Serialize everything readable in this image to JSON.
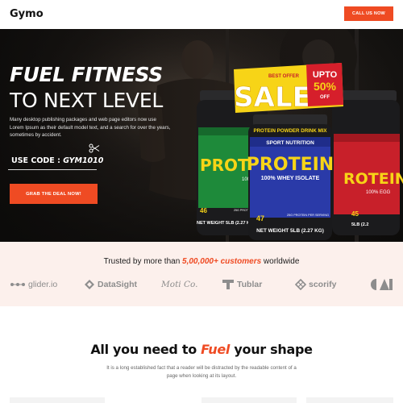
{
  "header": {
    "logo": "Gymo",
    "cta_label": "CALL US NOW"
  },
  "hero": {
    "title_line1": "FUEL FITNESS",
    "title_line2": "TO NEXT LEVEL",
    "description": "Many desktop publishing packages and web page editors now use Lorem Ipsum as their default model text, and a search for over the years, sometimes by accident.",
    "code_label": "USE CODE : ",
    "code_value": "GYM1010",
    "cta_label": "GRAB THE DEAL NOW!"
  },
  "promo": {
    "best_offer": "BEST OFFER",
    "sale": "SALE",
    "upto": "UPTO",
    "percent": "50%",
    "off": "OFF"
  },
  "products": [
    {
      "top_label": "PROTEIN POWDER DRINK MIX",
      "line": "SPORT NUTRITION",
      "name": "PROTEIN",
      "sub": "100% WHEY ISOLATE",
      "serving_num": "47",
      "serving_text": "25G PROTEIN PER SERVING",
      "weight": "NET WEIGHT 5LB (2.27 KG)"
    },
    {
      "left_name": "PROTEIN",
      "left_sub": "100%",
      "left_num": "46",
      "left_serving": "25G PROTEIN PER SERVING",
      "left_weight": "NET WEIGHT 5LB (2.27 KG)"
    },
    {
      "right_name": "ROTEIN",
      "right_sub": "100% EGG",
      "right_num": "45",
      "right_weight": "5LB (2.2"
    }
  ],
  "trusted": {
    "prefix": "Trusted by more than ",
    "highlight": "5,00,000+ customers",
    "suffix": " worldwide",
    "brands": [
      "glider.io",
      "DataSight",
      "Moti Co.",
      "Tublar",
      "scorify"
    ]
  },
  "section": {
    "title_pre": "All you need to ",
    "title_highlight": "Fuel",
    "title_post": " your shape",
    "desc": "It is a long established fact that a reader will be distracted by the readable content of a page when looking at its layout."
  },
  "colors": {
    "accent": "#ef4b23",
    "hero_bg": "#151311",
    "trusted_bg": "#fcf0ec",
    "jar_green": "#1e8a3a",
    "jar_blue": "#2a3aa8",
    "jar_red": "#c8202a",
    "label_yellow": "#f7d417"
  }
}
